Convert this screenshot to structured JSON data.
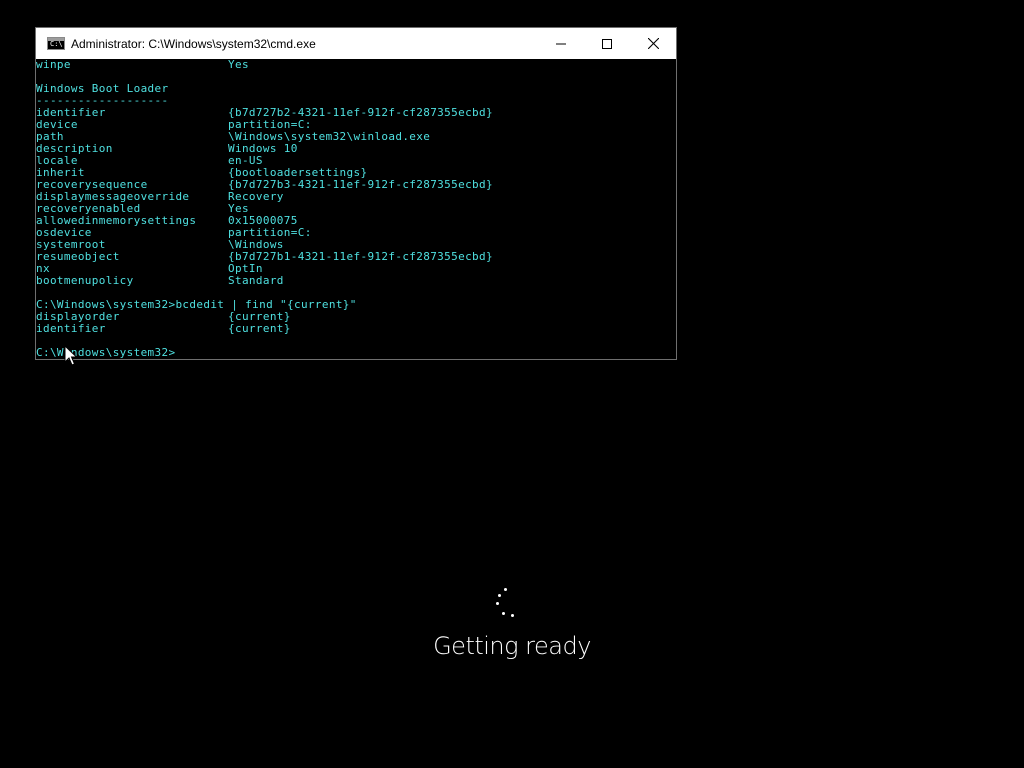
{
  "window": {
    "title": "Administrator: C:\\Windows\\system32\\cmd.exe",
    "icon_prompt": "C:\\",
    "controls": [
      "minimize-icon",
      "maximize-icon",
      "close-icon"
    ]
  },
  "console": {
    "lines": [
      {
        "k": "winpe",
        "v": "Yes"
      },
      {
        "k": "",
        "v": ""
      },
      {
        "k": "Windows Boot Loader",
        "v": ""
      },
      {
        "k": "-------------------",
        "v": ""
      },
      {
        "k": "identifier",
        "v": "{b7d727b2-4321-11ef-912f-cf287355ecbd}"
      },
      {
        "k": "device",
        "v": "partition=C:"
      },
      {
        "k": "path",
        "v": "\\Windows\\system32\\winload.exe"
      },
      {
        "k": "description",
        "v": "Windows 10"
      },
      {
        "k": "locale",
        "v": "en-US"
      },
      {
        "k": "inherit",
        "v": "{bootloadersettings}"
      },
      {
        "k": "recoverysequence",
        "v": "{b7d727b3-4321-11ef-912f-cf287355ecbd}"
      },
      {
        "k": "displaymessageoverride",
        "v": "Recovery"
      },
      {
        "k": "recoveryenabled",
        "v": "Yes"
      },
      {
        "k": "allowedinmemorysettings",
        "v": "0x15000075"
      },
      {
        "k": "osdevice",
        "v": "partition=C:"
      },
      {
        "k": "systemroot",
        "v": "\\Windows"
      },
      {
        "k": "resumeobject",
        "v": "{b7d727b1-4321-11ef-912f-cf287355ecbd}"
      },
      {
        "k": "nx",
        "v": "OptIn"
      },
      {
        "k": "bootmenupolicy",
        "v": "Standard"
      },
      {
        "k": "",
        "v": ""
      },
      {
        "k": "C:\\Windows\\system32>bcdedit | find \"{current}\"",
        "v": ""
      },
      {
        "k": "displayorder",
        "v": "{current}"
      },
      {
        "k": "identifier",
        "v": "{current}"
      },
      {
        "k": "",
        "v": ""
      },
      {
        "k": "C:\\Windows\\system32>",
        "v": ""
      }
    ]
  },
  "setup": {
    "status_text": "Getting ready"
  },
  "colors": {
    "console_text": "#4fe0e0",
    "background": "#000000",
    "titlebar": "#ffffff"
  }
}
